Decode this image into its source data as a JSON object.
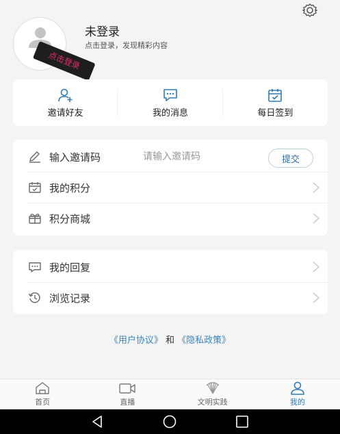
{
  "profile": {
    "title": "未登录",
    "subtitle": "点击登录，发现精彩内容",
    "tag": "点击登录"
  },
  "quick_actions": [
    {
      "label": "邀请好友",
      "icon": "add-user-icon"
    },
    {
      "label": "我的消息",
      "icon": "message-icon"
    },
    {
      "label": "每日签到",
      "icon": "calendar-check-icon"
    }
  ],
  "menu1": {
    "invite": {
      "label": "输入邀请码",
      "placeholder": "请输入邀请码",
      "button": "提交",
      "icon": "pencil-icon"
    },
    "points": {
      "label": "我的积分",
      "icon": "calendar-icon"
    },
    "mall": {
      "label": "积分商城",
      "icon": "gift-icon"
    }
  },
  "menu2": {
    "replies": {
      "label": "我的回复",
      "icon": "chat-icon"
    },
    "history": {
      "label": "浏览记录",
      "icon": "history-icon"
    }
  },
  "agreement": {
    "user": "《用户协议》",
    "and": " 和 ",
    "privacy": "《隐私政策》"
  },
  "tabs": [
    {
      "label": "首页",
      "icon": "home-icon",
      "active": false
    },
    {
      "label": "直播",
      "icon": "video-icon",
      "active": false
    },
    {
      "label": "文明实践",
      "icon": "civilization-icon",
      "active": false
    },
    {
      "label": "我的",
      "icon": "user-icon",
      "active": true
    }
  ],
  "colors": {
    "accent": "#2d7bb8",
    "link": "#3a86c0",
    "background": "#f4f4f4"
  }
}
